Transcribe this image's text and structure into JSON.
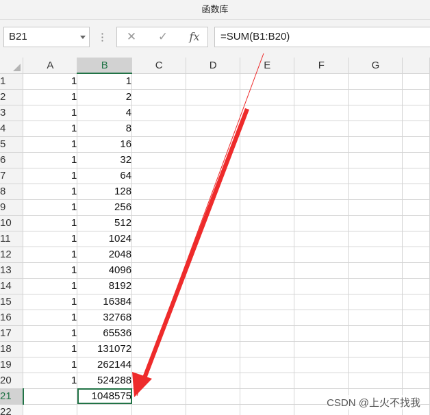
{
  "window": {
    "title": "函数库"
  },
  "formula_bar": {
    "name_box": "B21",
    "cancel_icon": "✕",
    "enter_icon": "✓",
    "fx_label": "fx",
    "formula": "=SUM(B1:B20)"
  },
  "columns": [
    "A",
    "B",
    "C",
    "D",
    "E",
    "F",
    "G"
  ],
  "rows": [
    {
      "n": "1",
      "a": "1",
      "b": "1"
    },
    {
      "n": "2",
      "a": "1",
      "b": "2"
    },
    {
      "n": "3",
      "a": "1",
      "b": "4"
    },
    {
      "n": "4",
      "a": "1",
      "b": "8"
    },
    {
      "n": "5",
      "a": "1",
      "b": "16"
    },
    {
      "n": "6",
      "a": "1",
      "b": "32"
    },
    {
      "n": "7",
      "a": "1",
      "b": "64"
    },
    {
      "n": "8",
      "a": "1",
      "b": "128"
    },
    {
      "n": "9",
      "a": "1",
      "b": "256"
    },
    {
      "n": "10",
      "a": "1",
      "b": "512"
    },
    {
      "n": "11",
      "a": "1",
      "b": "1024"
    },
    {
      "n": "12",
      "a": "1",
      "b": "2048"
    },
    {
      "n": "13",
      "a": "1",
      "b": "4096"
    },
    {
      "n": "14",
      "a": "1",
      "b": "8192"
    },
    {
      "n": "15",
      "a": "1",
      "b": "16384"
    },
    {
      "n": "16",
      "a": "1",
      "b": "32768"
    },
    {
      "n": "17",
      "a": "1",
      "b": "65536"
    },
    {
      "n": "18",
      "a": "1",
      "b": "131072"
    },
    {
      "n": "19",
      "a": "1",
      "b": "262144"
    },
    {
      "n": "20",
      "a": "1",
      "b": "524288"
    },
    {
      "n": "21",
      "a": "",
      "b": "1048575"
    },
    {
      "n": "22",
      "a": "",
      "b": ""
    }
  ],
  "selected": {
    "row": "21",
    "column": "B"
  },
  "accent_color": "#217346",
  "annotation_color": "#ee2b2b",
  "watermark": "CSDN @上火不找我"
}
